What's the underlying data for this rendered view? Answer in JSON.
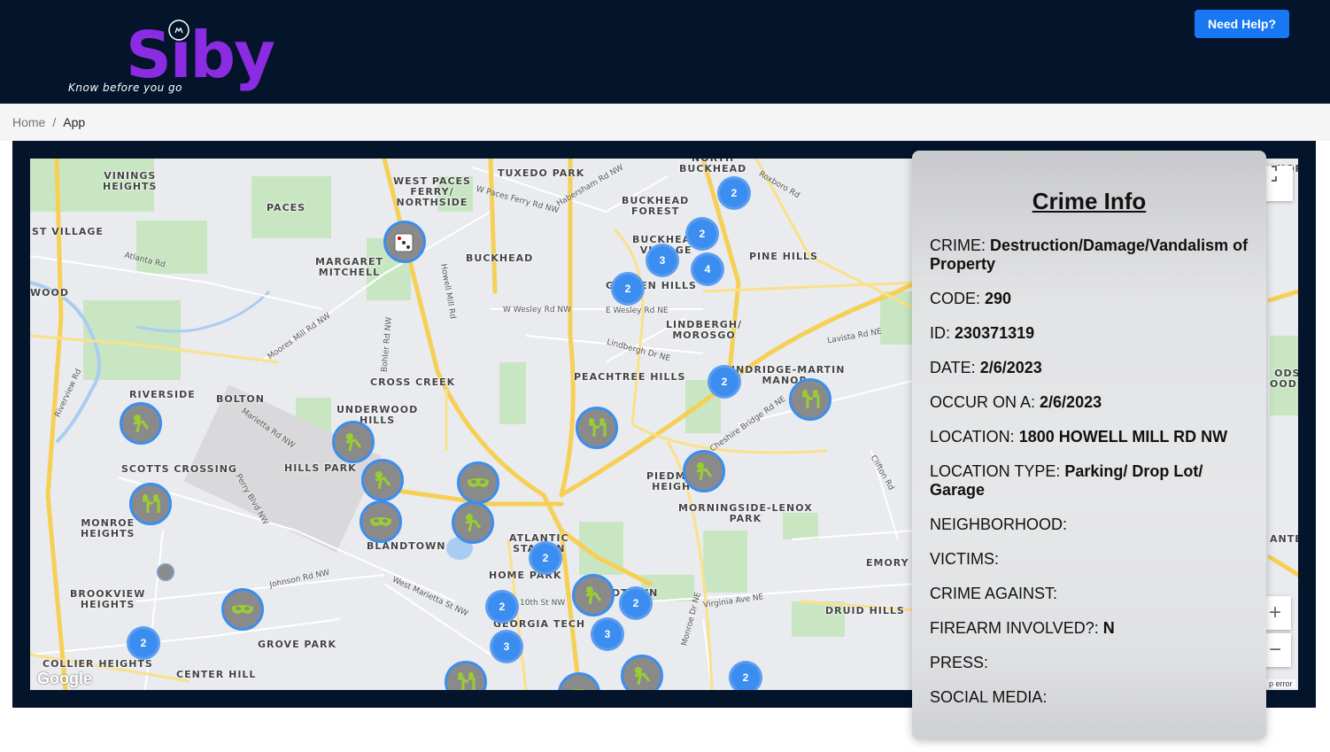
{
  "header": {
    "logo_text": "Siby",
    "tagline": "Know before you go",
    "help_button": "Need Help?"
  },
  "breadcrumb": {
    "home": "Home",
    "separator": "/",
    "current": "App"
  },
  "colors": {
    "nav_bg": "#04152b",
    "brand_purple": "#8b2be2",
    "accent_blue": "#1877f2",
    "cluster_blue": "#3b8ef0",
    "marker_icon_green": "#9acd32"
  },
  "map": {
    "labels": {
      "vinings": "VININGS\nHEIGHTS",
      "west_paces": "WEST PACES\nFERRY/\nNORTHSIDE",
      "tuxedo": "TUXEDO PARK",
      "north_buckhead": "NORTH\nBUCKHEAD",
      "paces": "PACES",
      "buckhead_forest": "BUCKHEAD\nFOREST",
      "st_village": "ST VILLAGE",
      "buckhead_village": "BUCKHEAD\nVILLAGE",
      "margaret": "MARGARET\nMITCHELL",
      "buckhead": "BUCKHEAD",
      "pine_hills": "PINE HILLS",
      "wood": "WOOD",
      "garden_hills": "GARDEN HILLS",
      "lindbergh": "LINDBERGH/\nMOROSGO",
      "cross_creek": "CROSS CREEK",
      "peachtree_hills": "PEACHTREE HILLS",
      "lindridge": "LINDRIDGE-MARTIN\nMANOR",
      "riverside": "RIVERSIDE",
      "bolton": "BOLTON",
      "underwood": "UNDERWOOD\nHILLS",
      "scotts": "SCOTTS CROSSING",
      "hills_park": "HILLS PARK",
      "piedmont": "PIEDMONT\nHEIGHTS",
      "morningside": "MORNINGSIDE-LENOX\nPARK",
      "monroe": "MONROE\nHEIGHTS",
      "blandtown": "BLANDTOWN",
      "atlantic": "ATLANTIC\nSTATION",
      "home_park": "HOME PARK",
      "midtown": "MIDTOWN",
      "emory": "EMORY",
      "brookview": "BROOKVIEW\nHEIGHTS",
      "georgia_tech": "GEORGIA TECH",
      "druid_hills": "DRUID HILLS",
      "grove_park": "GROVE PARK",
      "collier": "COLLIER HEIGHTS",
      "center_hill": "CENTER HILL",
      "woods_right": "ODS\nOODS",
      "ante": "ANTE",
      "hor": "HOR"
    },
    "roads": [
      "Atlanta Rd",
      "Moores Mill Rd NW",
      "W Paces Ferry Rd NW",
      "Habersham Rd NW",
      "Roxboro Rd",
      "W Wesley Rd NW",
      "E Wesley Rd NE",
      "Lindbergh Dr NE",
      "Howell Mill Rd",
      "Bohler Rd NW",
      "Marietta Rd NW",
      "Perry Blvd NW",
      "West Marietta St NW",
      "Johnson Rd NW",
      "Cheshire Bridge Rd NE",
      "Clifton Rd",
      "Virginia Ave NE",
      "Monroe Dr NE",
      "Riverview Rd",
      "10th St NW",
      "Lindbergh Dr NE",
      "Lavista Rd NE"
    ],
    "clusters": [
      "2",
      "2",
      "3",
      "4",
      "2",
      "2",
      "2",
      "2",
      "2",
      "3",
      "3",
      "2",
      "2"
    ],
    "zoom_in": "+",
    "zoom_out": "−",
    "fullscreen_icon": "fullscreen-icon",
    "attribution": "Google",
    "map_error": "p error"
  },
  "crime_info": {
    "title": "Crime Info",
    "crime_label": "CRIME:",
    "crime_value": "Destruction/Damage/Vandalism of Property",
    "code_label": "CODE:",
    "code_value": "290",
    "id_label": "ID:",
    "id_value": "230371319",
    "date_label": "DATE:",
    "date_value": "2/6/2023",
    "occur_label": "OCCUR ON A:",
    "occur_value": "2/6/2023",
    "location_label": "LOCATION:",
    "location_value": "1800 HOWELL MILL RD NW",
    "location_type_label": "LOCATION TYPE:",
    "location_type_value": "Parking/ Drop Lot/ Garage",
    "neighborhood_label": "NEIGHBORHOOD:",
    "victims_label": "VICTIMS:",
    "crime_against_label": "CRIME AGAINST:",
    "firearm_label": "FIREARM INVOLVED?:",
    "firearm_value": "N",
    "press_label": "PRESS:",
    "social_label": "SOCIAL MEDIA:"
  }
}
